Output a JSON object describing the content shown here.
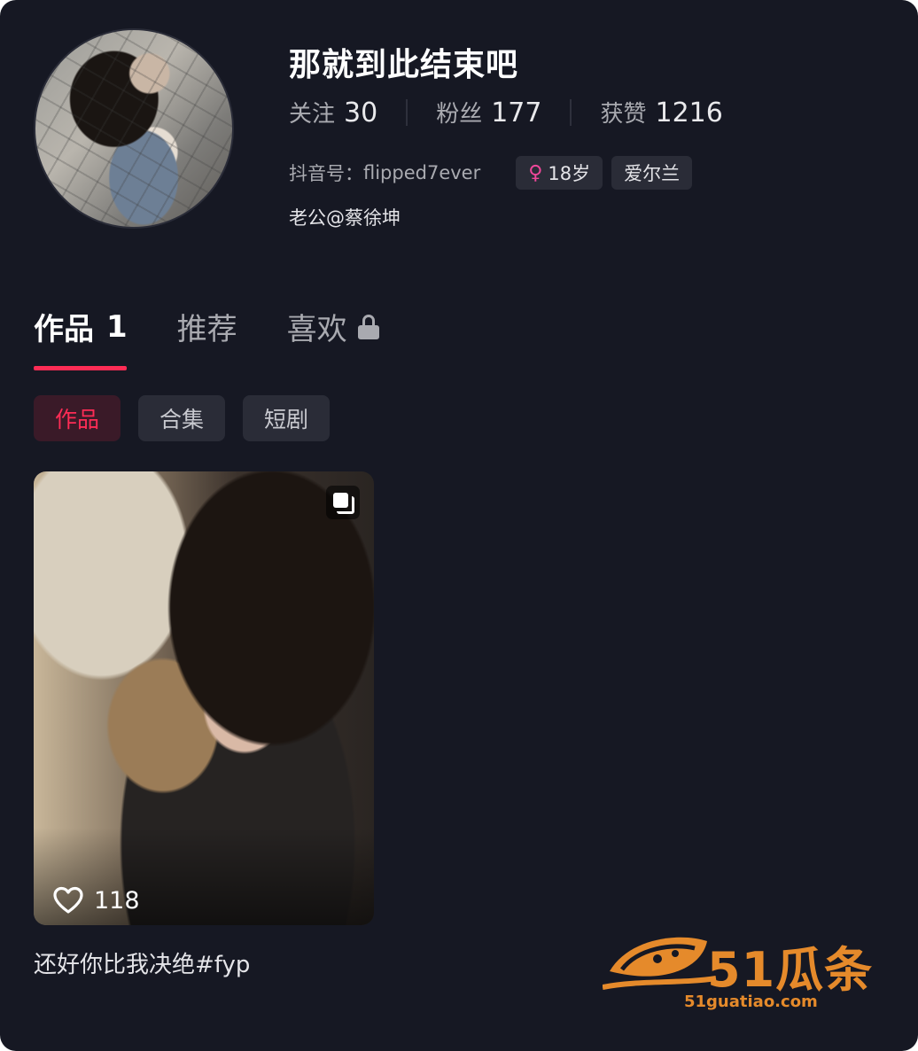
{
  "profile": {
    "name": "那就到此结束吧",
    "stats": [
      {
        "label": "关注",
        "value": "30"
      },
      {
        "label": "粉丝",
        "value": "177"
      },
      {
        "label": "获赞",
        "value": "1216"
      }
    ],
    "id_label": "抖音号：",
    "id_value": "flipped7ever",
    "age_tag": "18岁",
    "location_tag": "爱尔兰",
    "bio": "老公@蔡徐坤"
  },
  "tabs": [
    {
      "label": "作品",
      "count": "1"
    },
    {
      "label": "推荐"
    },
    {
      "label": "喜欢"
    }
  ],
  "subtabs": [
    "作品",
    "合集",
    "短剧"
  ],
  "videos": [
    {
      "likes": "118",
      "caption": "还好你比我决绝#fyp"
    }
  ],
  "watermark": {
    "main": "51瓜条",
    "sub": "51guatiao.com"
  },
  "colors": {
    "background": "#161823",
    "accent": "#fe2c55",
    "watermark": "#e58a2b"
  },
  "icons": [
    "lock-icon",
    "heart-icon",
    "multi-image-icon",
    "female-gender-icon"
  ]
}
